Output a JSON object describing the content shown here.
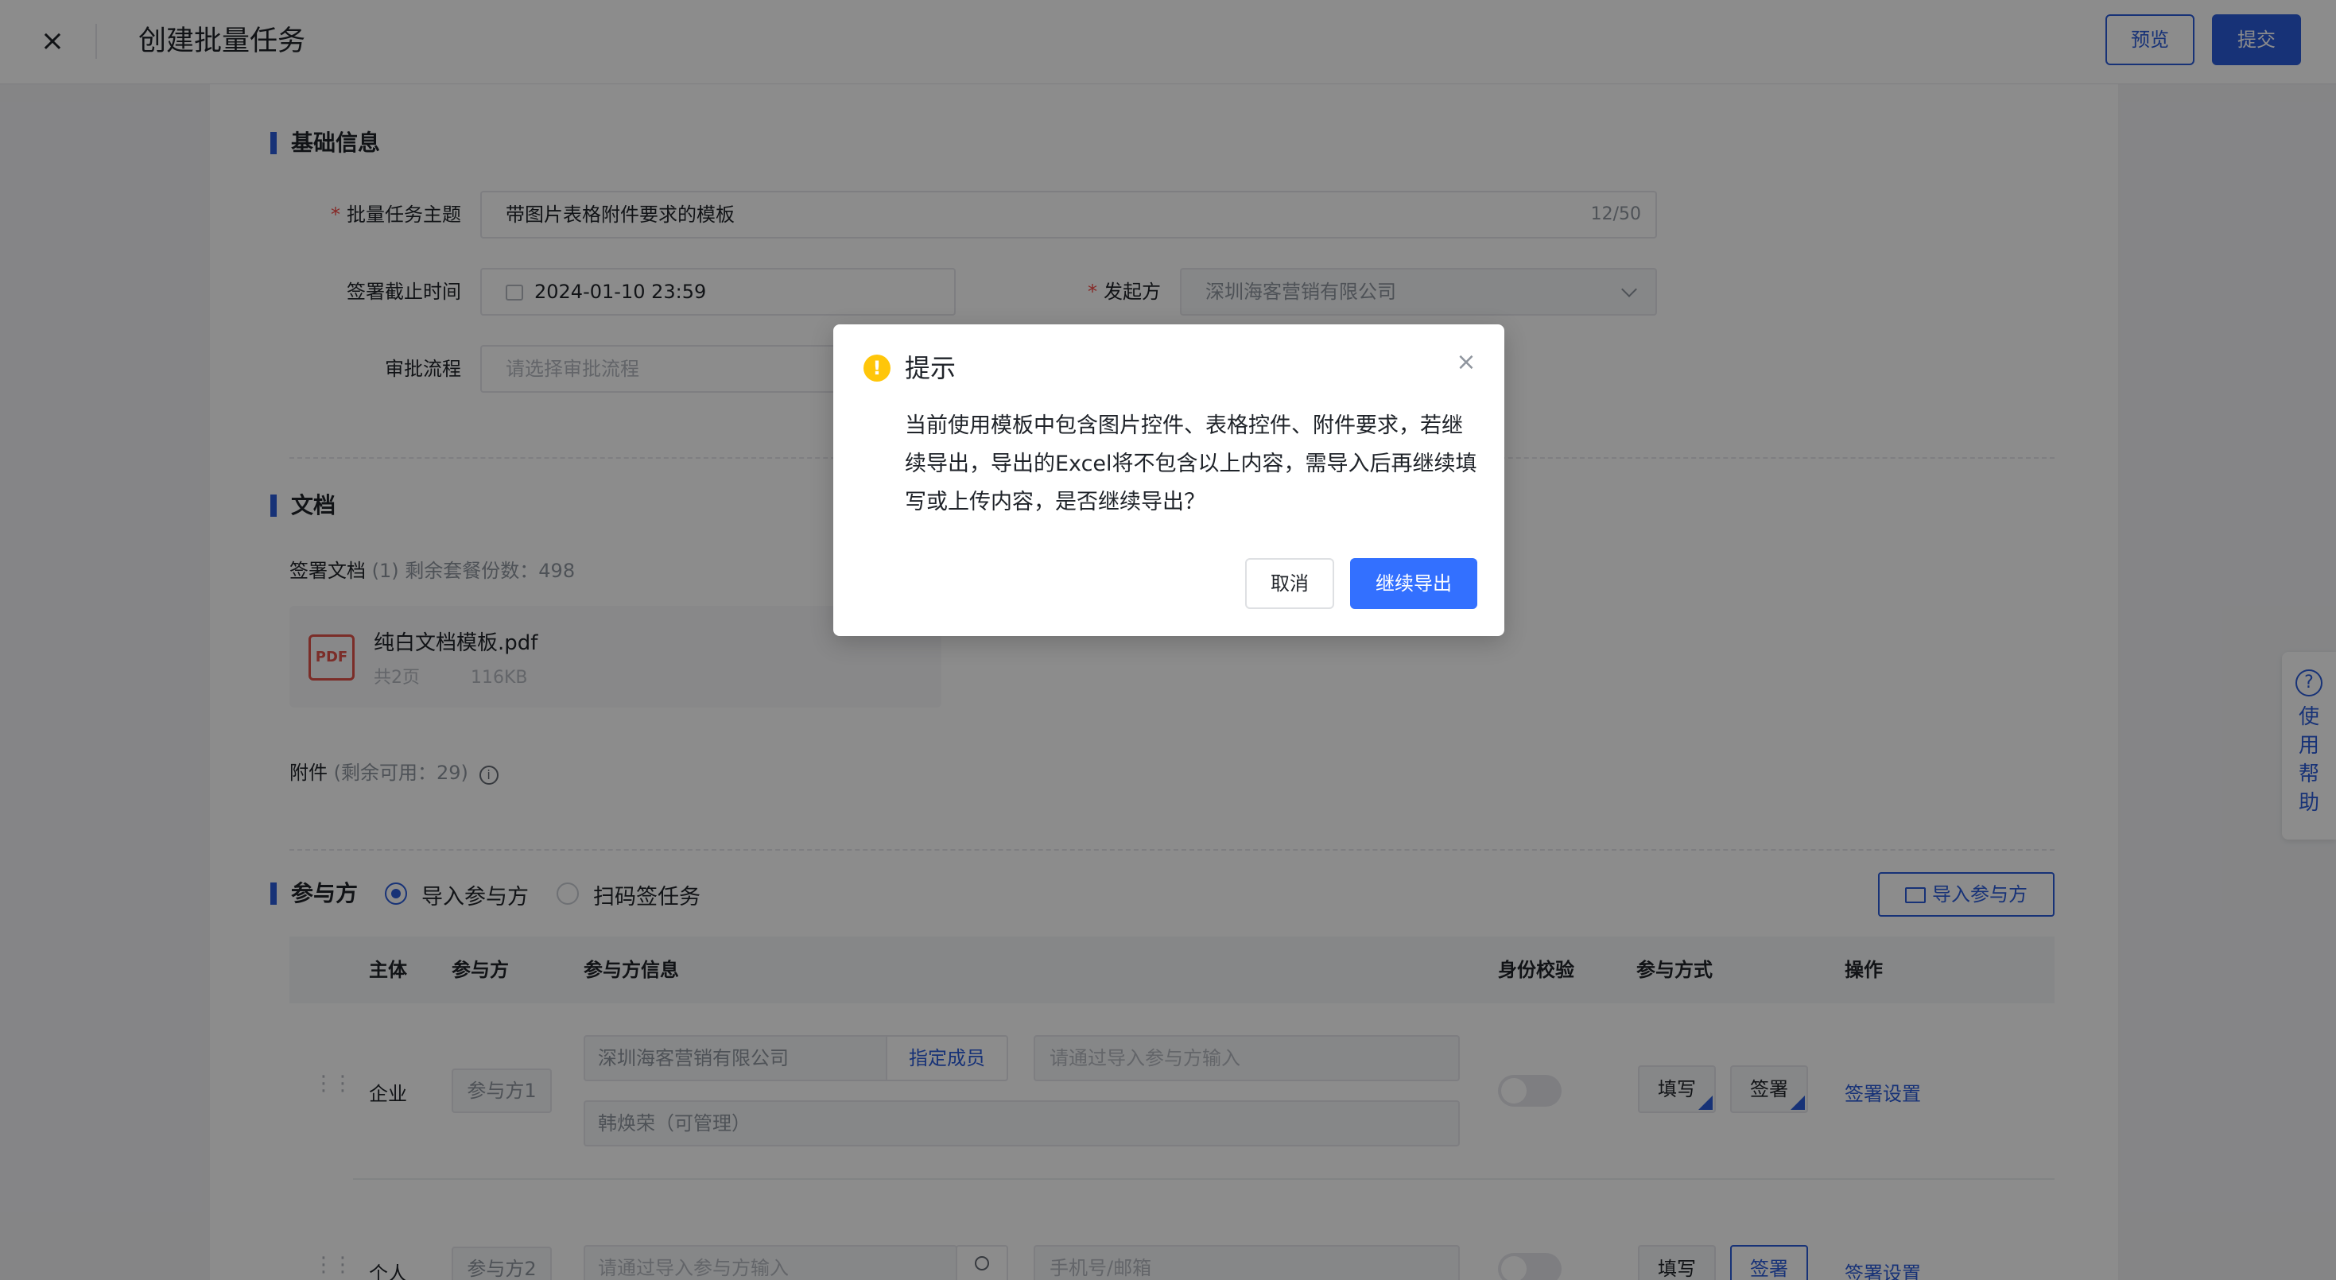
{
  "header": {
    "close_icon": "×",
    "title": "创建批量任务",
    "preview_label": "预览",
    "submit_label": "提交"
  },
  "basic": {
    "section_title": "基础信息",
    "subject_label": "批量任务主题",
    "subject_value": "带图片表格附件要求的模板",
    "subject_counter": "12/50",
    "deadline_label": "签署截止时间",
    "deadline_value": "2024-01-10 23:59",
    "initiator_label": "发起方",
    "initiator_value": "深圳海客营销有限公司",
    "approval_label": "审批流程",
    "approval_placeholder": "请选择审批流程",
    "required_mark": "*"
  },
  "documents": {
    "section_title": "文档",
    "sign_docs_label": "签署文档",
    "sign_docs_count": "(1)",
    "remaining_text": "剩余套餐份数：498",
    "file_icon": "PDF",
    "file_name": "纯白文档模板.pdf",
    "file_pages": "共2页",
    "file_size": "116KB",
    "attachments_label": "附件",
    "attachments_remaining": "(剩余可用：29)",
    "info_icon": "i"
  },
  "participants": {
    "section_title": "参与方",
    "radio_import": "导入参与方",
    "radio_scan": "扫码签任务",
    "import_button": "导入参与方",
    "columns": [
      "主体",
      "参与方",
      "参与方信息",
      "身份校验",
      "参与方式",
      "操作"
    ],
    "rows": [
      {
        "subject": "企业",
        "party": "参与方1",
        "company": "深圳海客营销有限公司",
        "assign_label": "指定成员",
        "import_placeholder": "请通过导入参与方输入",
        "member": "韩焕荣（可管理）",
        "mode_fill": "填写",
        "mode_sign": "签署",
        "action": "签署设置"
      },
      {
        "subject": "个人",
        "party": "参与方2",
        "name_placeholder": "请通过导入参与方输入",
        "contact_placeholder": "手机号/邮箱",
        "mode_fill": "填写",
        "mode_sign": "签署",
        "action": "签署设置"
      }
    ]
  },
  "help": {
    "icon": "?",
    "label": "使用帮助"
  },
  "dialog": {
    "icon": "!",
    "title": "提示",
    "close_icon": "×",
    "message": "当前使用模板中包含图片控件、表格控件、附件要求，若继续导出，导出的Excel将不包含以上内容，需导入后再继续填写或上传内容，是否继续导出？",
    "cancel_label": "取消",
    "confirm_label": "继续导出"
  },
  "colors": {
    "primary": "#2b5cd9",
    "dialog_primary": "#3370ff",
    "warning": "#ffc60a",
    "required": "#f54a45"
  }
}
